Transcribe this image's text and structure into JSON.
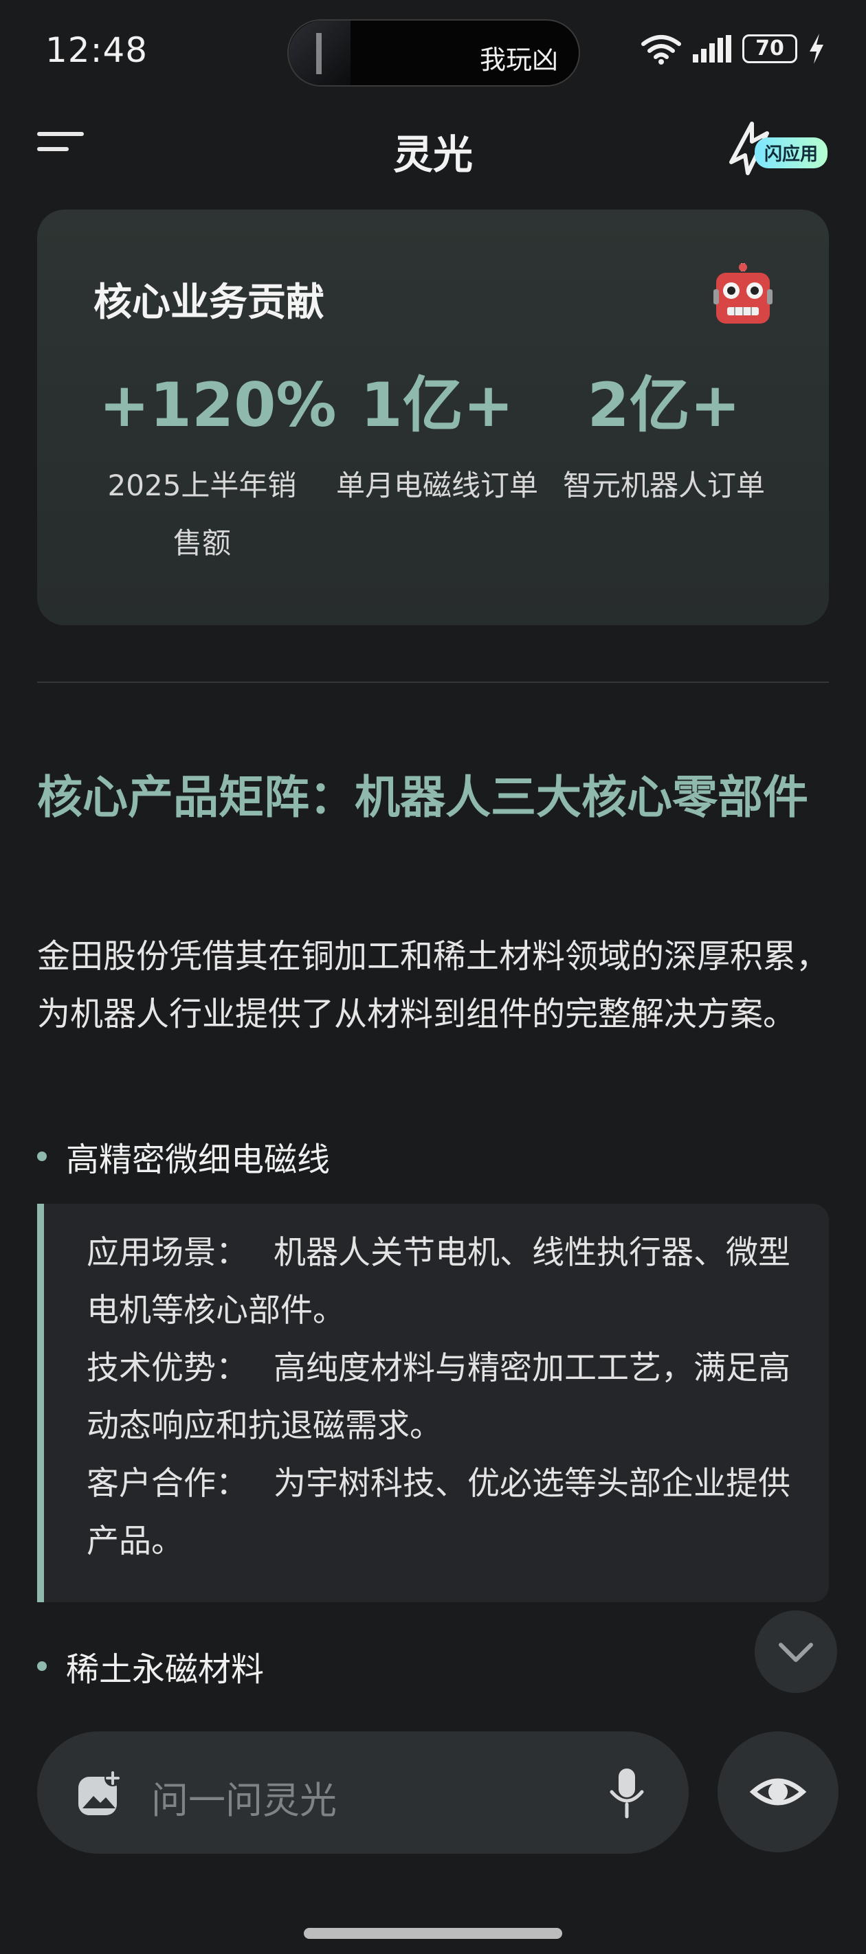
{
  "status_bar": {
    "time": "12:48",
    "island_text": "我玩凶",
    "battery": "70",
    "icons": [
      "wifi-icon",
      "signal-icon",
      "battery-icon",
      "charging-bolt-icon"
    ]
  },
  "nav": {
    "title": "灵光",
    "flash_app_label": "闪应用"
  },
  "stat_card": {
    "title": "核心业务贡献",
    "icon": "robot-icon",
    "stats": [
      {
        "value": "+120%",
        "label": "2025上半年销售额"
      },
      {
        "value": "1亿+",
        "label": "单月电磁线订单"
      },
      {
        "value": "2亿+",
        "label": "智元机器人订单"
      }
    ]
  },
  "section": {
    "heading": "核心产品矩阵：机器人三大核心零部件",
    "intro": "金田股份凭借其在铜加工和稀土材料领域的深厚积累，为机器人行业提供了从材料到组件的完整解决方案。",
    "bullets": [
      "高精密微细电磁线",
      "稀土永磁材料"
    ],
    "quote_lines": [
      {
        "label": "应用场景：",
        "text": "机器人关节电机、线性执行器、微型电机等核心部件。"
      },
      {
        "label": "技术优势：",
        "text": "高纯度材料与精密加工工艺，满足高动态响应和抗退磁需求。"
      },
      {
        "label": "客户合作：",
        "text": "为宇树科技、优必选等头部企业提供产品。"
      }
    ]
  },
  "input": {
    "placeholder": "问一问灵光"
  },
  "colors": {
    "accent": "#8fb9ad",
    "background": "#1a1b1d",
    "card": "#2a3030"
  }
}
